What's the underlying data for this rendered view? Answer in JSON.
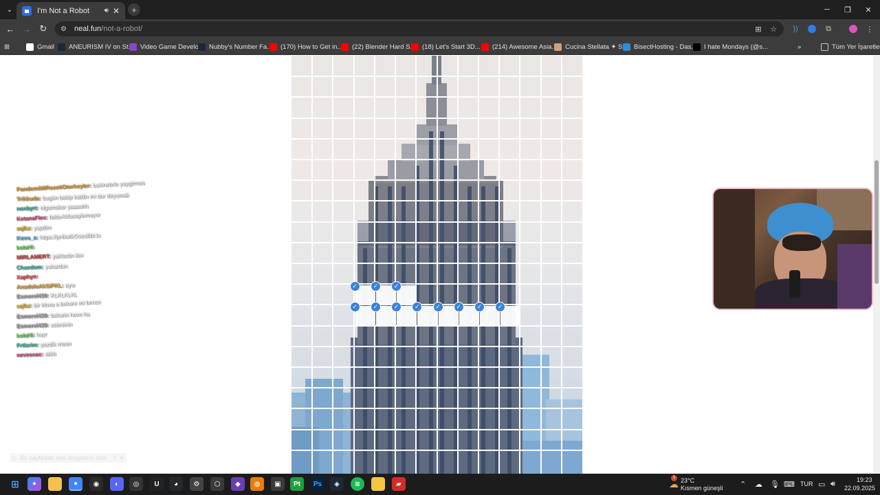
{
  "tab": {
    "title": "I'm Not a Robot"
  },
  "address": {
    "host": "neal.fun",
    "path": "/not-a-robot/"
  },
  "bookmarks": [
    {
      "label": "Gmail",
      "color": "#ffffff"
    },
    {
      "label": "ANEURISM IV on St...",
      "color": "#1b2838"
    },
    {
      "label": "Video Game Develo...",
      "color": "#8a47c2"
    },
    {
      "label": "Nubby's Number Fa...",
      "color": "#1b2838"
    },
    {
      "label": "(170) How to Get in...",
      "color": "#ff0000"
    },
    {
      "label": "(22) Blender Hard S...",
      "color": "#ff0000"
    },
    {
      "label": "(18) Let's Start 3D...",
      "color": "#ff0000"
    },
    {
      "label": "(214) Awesome Asia...",
      "color": "#ff0000"
    },
    {
      "label": "Cucina Stellata ✦ St...",
      "color": "#c9a080"
    },
    {
      "label": "BisectHosting - Das...",
      "color": "#2a8ed8"
    },
    {
      "label": "I hate Mondays (@s...",
      "color": "#000000"
    }
  ],
  "bookmarks_folder": "Tüm Yer İşaretleri",
  "chat": [
    {
      "user": "PandemiMIRozetiOtorkeyler:",
      "msg": "bakinebrle yaygirmas",
      "color": "#e09a2a"
    },
    {
      "user": "Trikkuda:",
      "msg": "bugün bakip kaldin mi dur deyumak",
      "color": "#e0a030"
    },
    {
      "user": "noxbyrt:",
      "msg": "olgamakar yaaaahh",
      "color": "#2fa8a0"
    },
    {
      "user": "KetanaFlex:",
      "msg": "faldeAkfasaylemuyor",
      "color": "#d04a6a"
    },
    {
      "user": "sqlkz:",
      "msg": "yapdim",
      "color": "#e6b020"
    },
    {
      "user": "Kovu_a:",
      "msg": "https://pnlkaIkOvea8bt.lu",
      "color": "#4aa6e6"
    },
    {
      "user": "kolaHi:",
      "msg": "",
      "color": "#6ad04a"
    },
    {
      "user": "MIRLAMERT:",
      "msg": "yaklastin kiw",
      "color": "#cf3a3a"
    },
    {
      "user": "Chaedom:",
      "msg": "yukardan",
      "color": "#2fb896"
    },
    {
      "user": "Xaphyn:",
      "msg": "",
      "color": "#e23c3c"
    },
    {
      "user": "AnadoluAkSiPKL:",
      "msg": "ayw",
      "color": "#e0a030"
    },
    {
      "user": "Esmerel439:",
      "msg": "KLKLKLKL",
      "color": "#a0a0a0"
    },
    {
      "user": "sqlkz:",
      "msg": "bir kloxa a bekare mi bence",
      "color": "#e6b020"
    },
    {
      "user": "Esmerel439:",
      "msg": "bekarin hoxo ha",
      "color": "#a0a0a0"
    },
    {
      "user": "Esmerel439:",
      "msg": "ustesinin",
      "color": "#a0a0a0"
    },
    {
      "user": "kolaHi:",
      "msg": "hayr",
      "color": "#6ad04a"
    },
    {
      "user": "Frtlarim:",
      "msg": "yazdik mean",
      "color": "#2fb896"
    },
    {
      "user": "nevesnac:",
      "msg": "akkk",
      "color": "#d04a6a"
    }
  ],
  "download_hint": "Bu sayfadan ses dosyasını indir",
  "captcha": {
    "columns": 14,
    "rows": 20,
    "checked_row1": [
      3,
      4,
      5
    ],
    "checked_row2": [
      3,
      4,
      5,
      6,
      7,
      8,
      9,
      10
    ]
  },
  "tray": {
    "temperature": "23°C",
    "weather": "Kısmen güneşli",
    "lang": "TUR",
    "time": "19:23",
    "date": "22.09.2025",
    "weather_badge": "1"
  },
  "colors": {
    "accent": "#3c82d6",
    "chrome_dark": "#3c3c3c"
  }
}
